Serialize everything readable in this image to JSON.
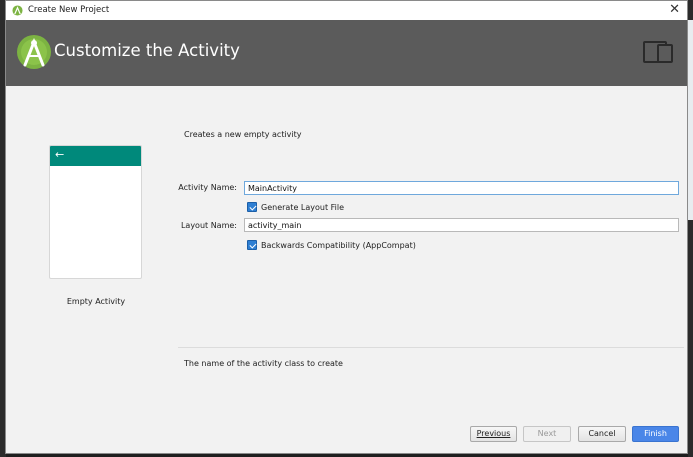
{
  "window": {
    "title": "Create New Project",
    "close_glyph": "✕"
  },
  "header": {
    "title": "Customize the Activity",
    "logo_icon": "android-studio-icon",
    "device_icon": "phone-tablet-icon",
    "background": "#5b5b5b"
  },
  "preview": {
    "label": "Empty Activity",
    "appbar_color": "#00897b",
    "back_glyph": "←"
  },
  "form": {
    "description": "Creates a new empty activity",
    "activity_name": {
      "label": "Activity Name:",
      "value": "MainActivity"
    },
    "generate_layout": {
      "label": "Generate Layout File",
      "checked": true
    },
    "layout_name": {
      "label": "Layout Name:",
      "value": "activity_main"
    },
    "backwards_compat": {
      "label": "Backwards Compatibility (AppCompat)",
      "checked": true
    },
    "help_text": "The name of the activity class to create"
  },
  "buttons": {
    "previous": "Previous",
    "next": "Next",
    "cancel": "Cancel",
    "finish": "Finish",
    "accent": "#4a86e8"
  }
}
